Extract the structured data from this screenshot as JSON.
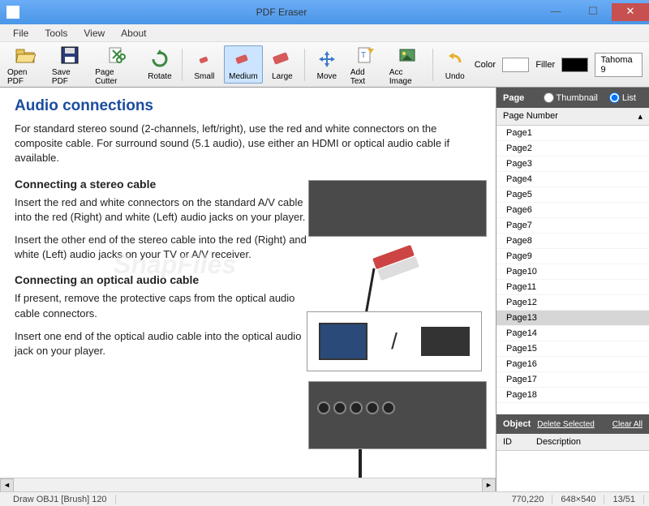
{
  "window": {
    "title": "PDF Eraser"
  },
  "menu": {
    "file": "File",
    "tools": "Tools",
    "view": "View",
    "about": "About"
  },
  "toolbar": {
    "open_pdf": "Open PDF",
    "save_pdf": "Save PDF",
    "page_cutter": "Page Cutter",
    "rotate": "Rotate",
    "small": "Small",
    "medium": "Medium",
    "large": "Large",
    "move": "Move",
    "add_text": "Add Text",
    "acc_image": "Acc Image",
    "undo": "Undo",
    "color_label": "Color",
    "filler_label": "Filler",
    "font": "Tahoma 9"
  },
  "doc": {
    "h1": "Audio connections",
    "p1": "For standard stereo sound (2-channels, left/right), use the red and white connectors on the composite cable. For surround sound (5.1 audio), use either an HDMI or optical audio cable if available.",
    "h2a": "Connecting a stereo cable",
    "p2": "Insert the red and white connectors on the standard A/V cable into the red (Right) and white (Left) audio jacks on your player.",
    "p3": "Insert the other end of the stereo cable into the red (Right) and white (Left) audio jacks on your TV or A/V receiver.",
    "h2b": "Connecting an optical audio cable",
    "p4": "If present, remove the protective caps from the optical audio cable connectors.",
    "p5": "Insert one end of the optical audio cable into the optical audio jack on your player.",
    "watermark": "SnapFiles"
  },
  "side": {
    "page_header": "Page",
    "thumbnail": "Thumbnail",
    "list": "List",
    "col_head": "Page Number",
    "pages": [
      "Page1",
      "Page2",
      "Page3",
      "Page4",
      "Page5",
      "Page6",
      "Page7",
      "Page8",
      "Page9",
      "Page10",
      "Page11",
      "Page12",
      "Page13",
      "Page14",
      "Page15",
      "Page16",
      "Page17",
      "Page18"
    ],
    "selected_index": 12,
    "obj_header": "Object",
    "delete_selected": "Delete Selected",
    "clear_all": "Clear All",
    "obj_col_id": "ID",
    "obj_col_desc": "Description"
  },
  "status": {
    "draw": "Draw OBJ1 [Brush] 120",
    "coords": "770,220",
    "dims": "648×540",
    "page": "13/51"
  }
}
